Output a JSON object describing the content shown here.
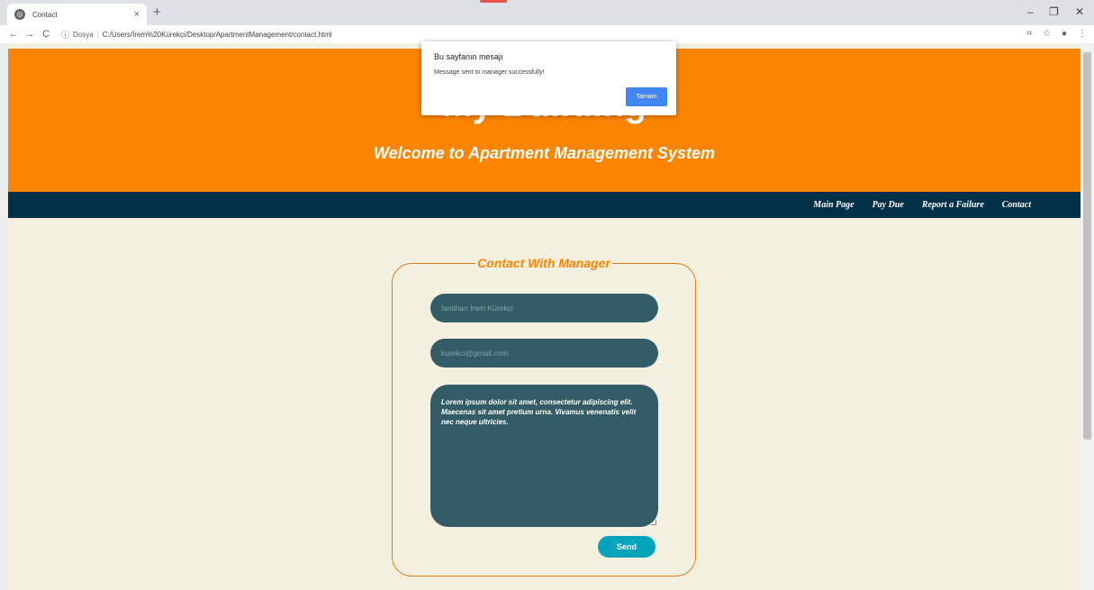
{
  "browser": {
    "tab_title": "Contact",
    "tab_close": "×",
    "new_tab": "+",
    "address_scheme": "Dosya",
    "address_url": "C:/Users/İrem%20Kürekçi/Desktop/ApartmentManagement/contact.html",
    "window_min": "–",
    "window_restore": "❐",
    "window_close": "✕"
  },
  "page": {
    "banner_title": "My Building",
    "banner_subtitle": "Welcome to Apartment Management System",
    "nav": [
      "Main Page",
      "Pay Due",
      "Report a Failure",
      "Contact"
    ],
    "form": {
      "legend": "Contact With Manager",
      "name_placeholder": "İsmihan İrem Kürekçi",
      "email_placeholder": "kurekci@gmail.com",
      "message": "Lorem ipsum dolor sit amet, consectetur adipiscing elit. Maecenas sit amet pretium urna. Vivamus venenatis velit nec neque ultricies.",
      "send_label": "Send"
    }
  },
  "dialog": {
    "title": "Bu sayfanın mesajı",
    "message": "Message sent to manager successfully!",
    "ok_label": "Tamam"
  },
  "colors": {
    "banner": "#fb8500",
    "navbar": "#023047",
    "background": "#f4f0df",
    "field": "#335c67",
    "send_button": "#06a3bd",
    "accent_border": "#e07b1a"
  }
}
